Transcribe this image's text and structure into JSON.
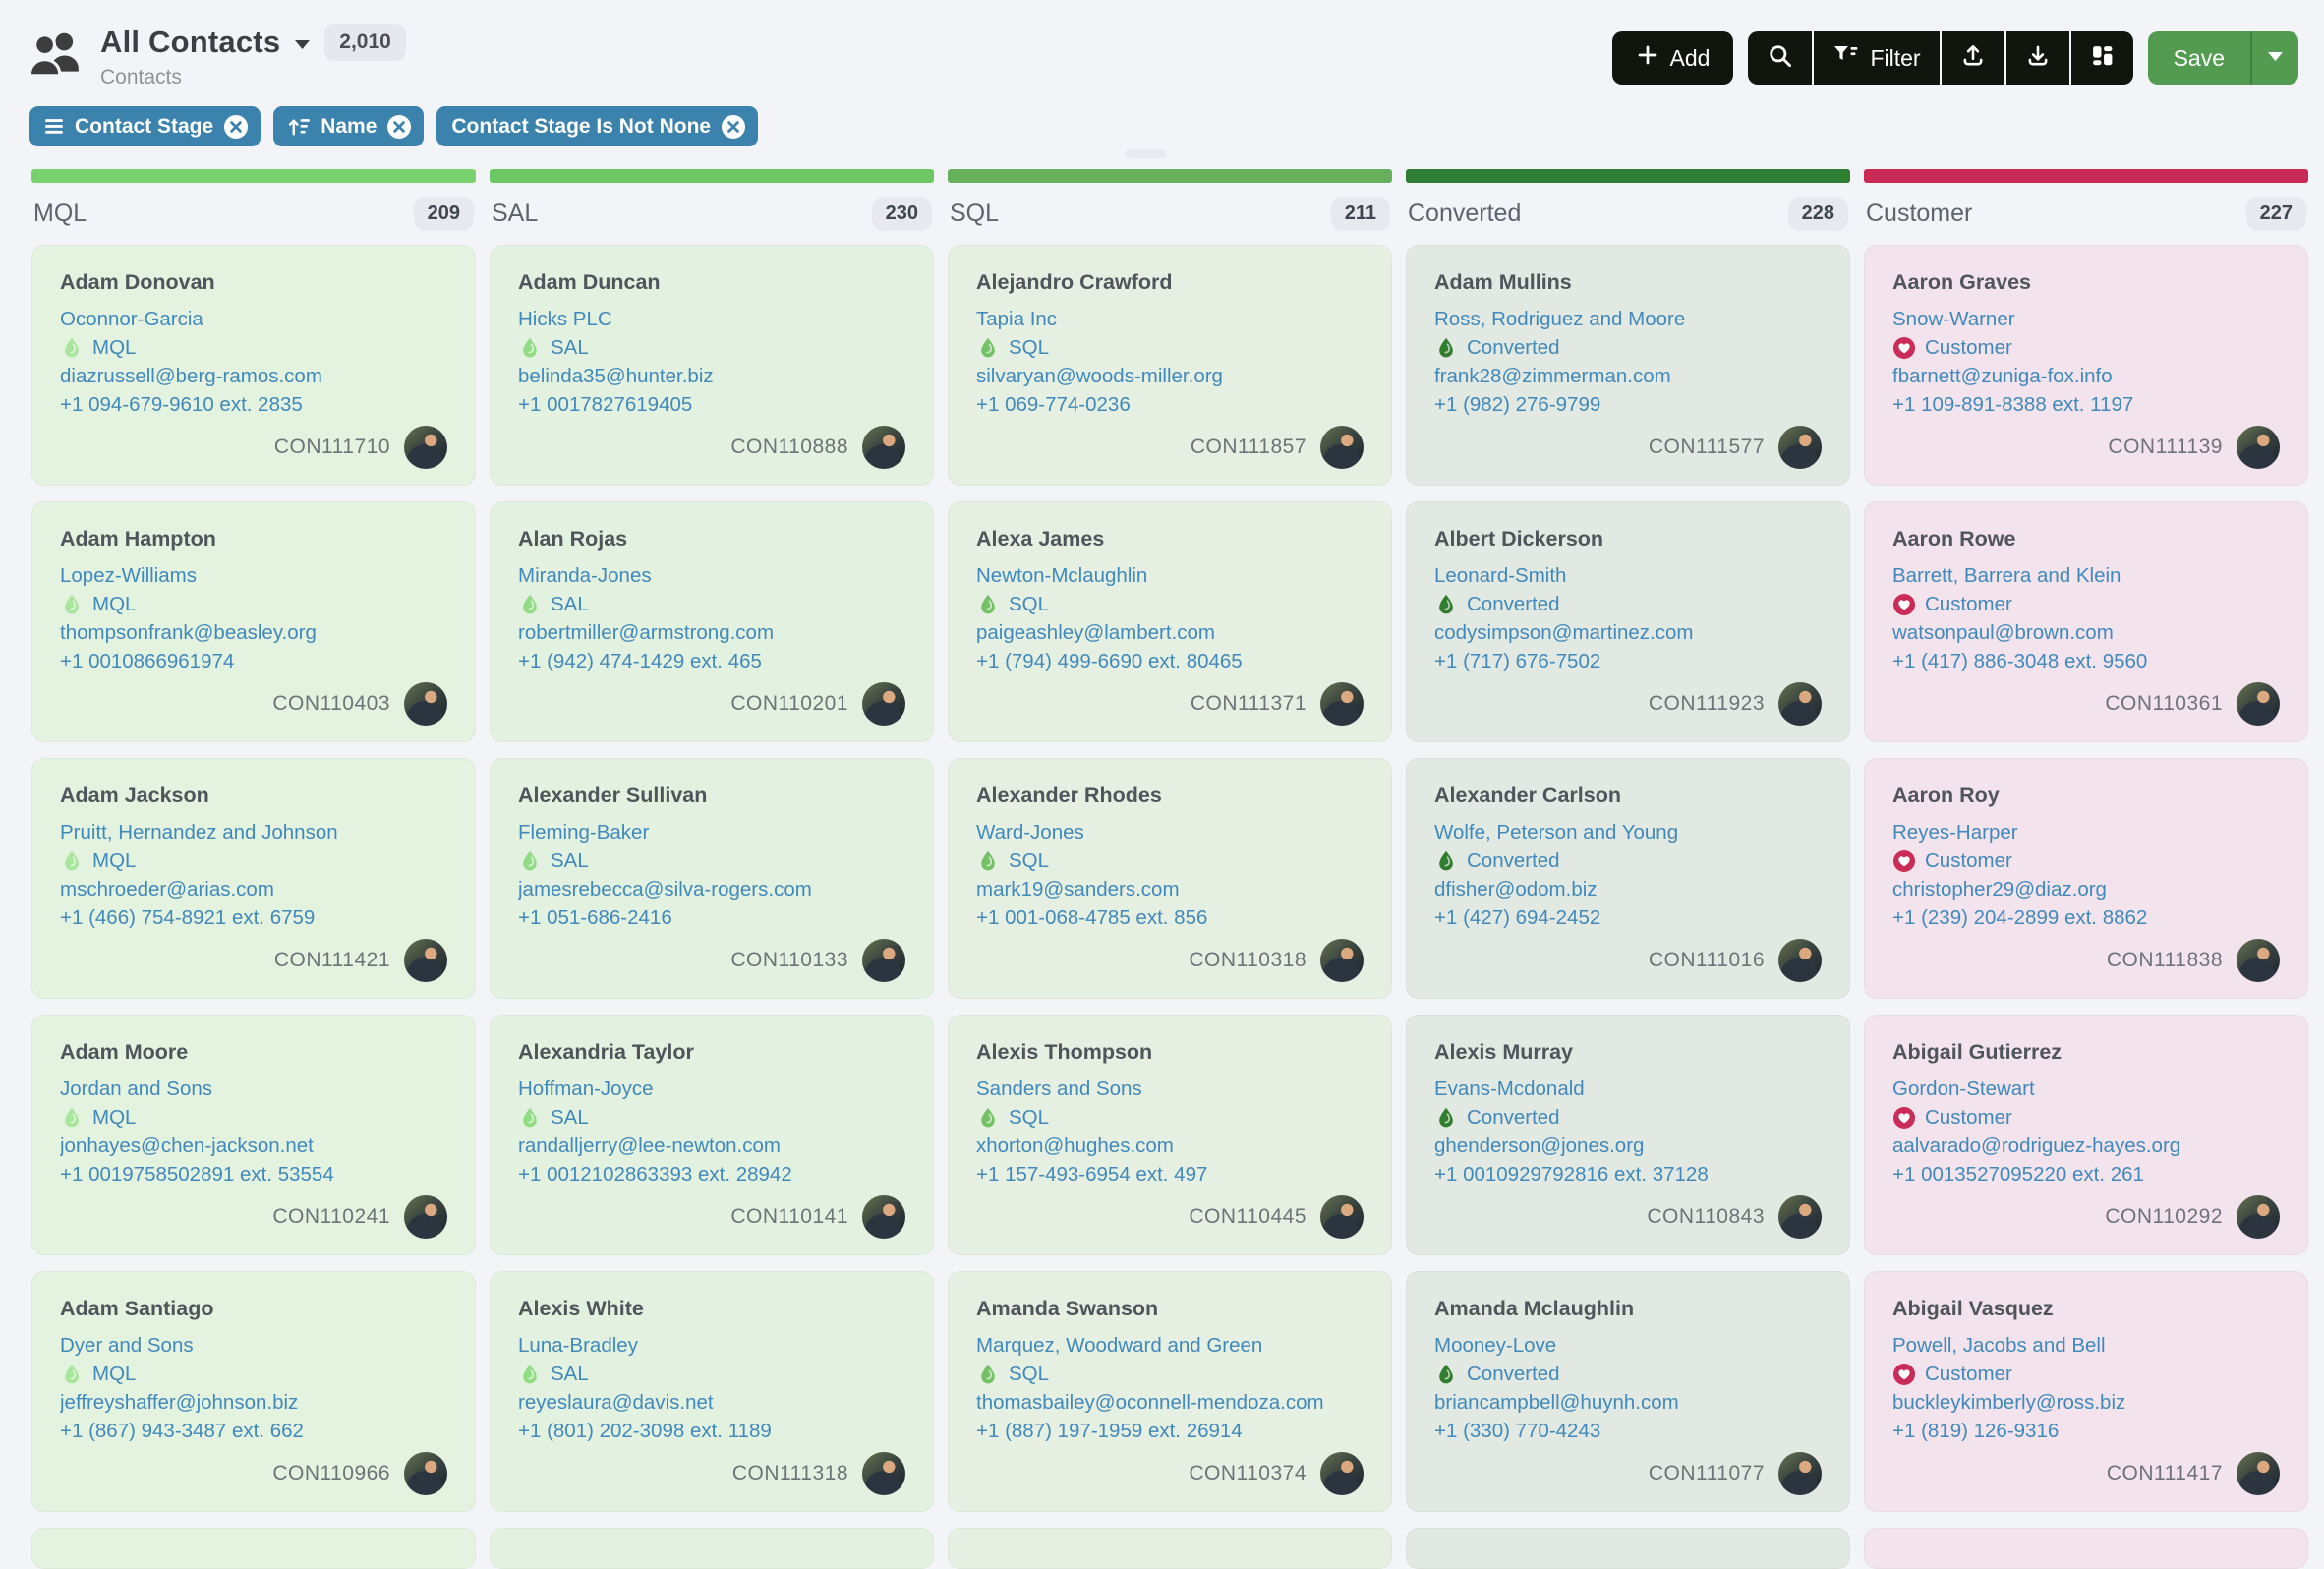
{
  "header": {
    "title": "All Contacts",
    "count_badge": "2,010",
    "subtitle": "Contacts",
    "toolbar": {
      "add_label": "Add",
      "filter_label": "Filter",
      "save_label": "Save"
    }
  },
  "filters": [
    {
      "label": "Contact Stage",
      "icon": "group-icon"
    },
    {
      "label": "Name",
      "icon": "sort-icon"
    },
    {
      "label": "Contact Stage Is Not None",
      "icon": null
    }
  ],
  "colors": {
    "chip_blue": "#3b82ad",
    "link_blue": "#4189ba",
    "button_black": "#10150e",
    "save_green": "#539b51",
    "page_background": "#f3f4f8"
  },
  "board": {
    "columns": [
      {
        "name": "MQL",
        "count": "209",
        "bar_color": "#79d26e",
        "card_bg": "#e4f2e0",
        "stage_icon": "flame",
        "stage_icon_color": "#a9e59c",
        "cards": [
          {
            "contact_name": "Adam Donovan",
            "company": "Oconnor-Garcia",
            "stage": "MQL",
            "email": "diazrussell@berg-ramos.com",
            "phone": "+1 094-679-9610 ext. 2835",
            "id": "CON111710"
          },
          {
            "contact_name": "Adam Hampton",
            "company": "Lopez-Williams",
            "stage": "MQL",
            "email": "thompsonfrank@beasley.org",
            "phone": "+1 0010866961974",
            "id": "CON110403"
          },
          {
            "contact_name": "Adam Jackson",
            "company": "Pruitt, Hernandez and Johnson",
            "stage": "MQL",
            "email": "mschroeder@arias.com",
            "phone": "+1 (466) 754-8921 ext. 6759",
            "id": "CON111421"
          },
          {
            "contact_name": "Adam Moore",
            "company": "Jordan and Sons",
            "stage": "MQL",
            "email": "jonhayes@chen-jackson.net",
            "phone": "+1 0019758502891 ext. 53554",
            "id": "CON110241"
          },
          {
            "contact_name": "Adam Santiago",
            "company": "Dyer and Sons",
            "stage": "MQL",
            "email": "jeffreyshaffer@johnson.biz",
            "phone": "+1 (867) 943-3487 ext. 662",
            "id": "CON110966"
          }
        ]
      },
      {
        "name": "SAL",
        "count": "230",
        "bar_color": "#6cc763",
        "card_bg": "#e3f1e0",
        "stage_icon": "flame",
        "stage_icon_color": "#92dc86",
        "cards": [
          {
            "contact_name": "Adam Duncan",
            "company": "Hicks PLC",
            "stage": "SAL",
            "email": "belinda35@hunter.biz",
            "phone": "+1 0017827619405",
            "id": "CON110888"
          },
          {
            "contact_name": "Alan Rojas",
            "company": "Miranda-Jones",
            "stage": "SAL",
            "email": "robertmiller@armstrong.com",
            "phone": "+1 (942) 474-1429 ext. 465",
            "id": "CON110201"
          },
          {
            "contact_name": "Alexander Sullivan",
            "company": "Fleming-Baker",
            "stage": "SAL",
            "email": "jamesrebecca@silva-rogers.com",
            "phone": "+1 051-686-2416",
            "id": "CON110133"
          },
          {
            "contact_name": "Alexandria Taylor",
            "company": "Hoffman-Joyce",
            "stage": "SAL",
            "email": "randalljerry@lee-newton.com",
            "phone": "+1 0012102863393 ext. 28942",
            "id": "CON110141"
          },
          {
            "contact_name": "Alexis White",
            "company": "Luna-Bradley",
            "stage": "SAL",
            "email": "reyeslaura@davis.net",
            "phone": "+1 (801) 202-3098 ext. 1189",
            "id": "CON111318"
          }
        ]
      },
      {
        "name": "SQL",
        "count": "211",
        "bar_color": "#66b05c",
        "card_bg": "#e5efe2",
        "stage_icon": "flame",
        "stage_icon_color": "#74c167",
        "cards": [
          {
            "contact_name": "Alejandro Crawford",
            "company": "Tapia Inc",
            "stage": "SQL",
            "email": "silvaryan@woods-miller.org",
            "phone": "+1 069-774-0236",
            "id": "CON111857"
          },
          {
            "contact_name": "Alexa James",
            "company": "Newton-Mclaughlin",
            "stage": "SQL",
            "email": "paigeashley@lambert.com",
            "phone": "+1 (794) 499-6690 ext. 80465",
            "id": "CON111371"
          },
          {
            "contact_name": "Alexander Rhodes",
            "company": "Ward-Jones",
            "stage": "SQL",
            "email": "mark19@sanders.com",
            "phone": "+1 001-068-4785 ext. 856",
            "id": "CON110318"
          },
          {
            "contact_name": "Alexis Thompson",
            "company": "Sanders and Sons",
            "stage": "SQL",
            "email": "xhorton@hughes.com",
            "phone": "+1 157-493-6954 ext. 497",
            "id": "CON110445"
          },
          {
            "contact_name": "Amanda Swanson",
            "company": "Marquez, Woodward and Green",
            "stage": "SQL",
            "email": "thomasbailey@oconnell-mendoza.com",
            "phone": "+1 (887) 197-1959 ext. 26914",
            "id": "CON110374"
          }
        ]
      },
      {
        "name": "Converted",
        "count": "228",
        "bar_color": "#2e7d32",
        "card_bg": "#e1e9e2",
        "stage_icon": "flame",
        "stage_icon_color": "#317d2f",
        "cards": [
          {
            "contact_name": "Adam Mullins",
            "company": "Ross, Rodriguez and Moore",
            "stage": "Converted",
            "email": "frank28@zimmerman.com",
            "phone": "+1 (982) 276-9799",
            "id": "CON111577"
          },
          {
            "contact_name": "Albert Dickerson",
            "company": "Leonard-Smith",
            "stage": "Converted",
            "email": "codysimpson@martinez.com",
            "phone": "+1 (717) 676-7502",
            "id": "CON111923"
          },
          {
            "contact_name": "Alexander Carlson",
            "company": "Wolfe, Peterson and Young",
            "stage": "Converted",
            "email": "dfisher@odom.biz",
            "phone": "+1 (427) 694-2452",
            "id": "CON111016"
          },
          {
            "contact_name": "Alexis Murray",
            "company": "Evans-Mcdonald",
            "stage": "Converted",
            "email": "ghenderson@jones.org",
            "phone": "+1 0010929792816 ext. 37128",
            "id": "CON110843"
          },
          {
            "contact_name": "Amanda Mclaughlin",
            "company": "Mooney-Love",
            "stage": "Converted",
            "email": "briancampbell@huynh.com",
            "phone": "+1 (330) 770-4243",
            "id": "CON111077"
          }
        ]
      },
      {
        "name": "Customer",
        "count": "227",
        "bar_color": "#c92b57",
        "card_bg": "#f2e3ec",
        "stage_icon": "heart",
        "stage_icon_color": "#cb2b57",
        "cards": [
          {
            "contact_name": "Aaron Graves",
            "company": "Snow-Warner",
            "stage": "Customer",
            "email": "fbarnett@zuniga-fox.info",
            "phone": "+1 109-891-8388 ext. 1197",
            "id": "CON111139"
          },
          {
            "contact_name": "Aaron Rowe",
            "company": "Barrett, Barrera and Klein",
            "stage": "Customer",
            "email": "watsonpaul@brown.com",
            "phone": "+1 (417) 886-3048 ext. 9560",
            "id": "CON110361"
          },
          {
            "contact_name": "Aaron Roy",
            "company": "Reyes-Harper",
            "stage": "Customer",
            "email": "christopher29@diaz.org",
            "phone": "+1 (239) 204-2899 ext. 8862",
            "id": "CON111838"
          },
          {
            "contact_name": "Abigail Gutierrez",
            "company": "Gordon-Stewart",
            "stage": "Customer",
            "email": "aalvarado@rodriguez-hayes.org",
            "phone": "+1 0013527095220 ext. 261",
            "id": "CON110292"
          },
          {
            "contact_name": "Abigail Vasquez",
            "company": "Powell, Jacobs and Bell",
            "stage": "Customer",
            "email": "buckleykimberly@ross.biz",
            "phone": "+1 (819) 126-9316",
            "id": "CON111417"
          }
        ]
      }
    ]
  }
}
